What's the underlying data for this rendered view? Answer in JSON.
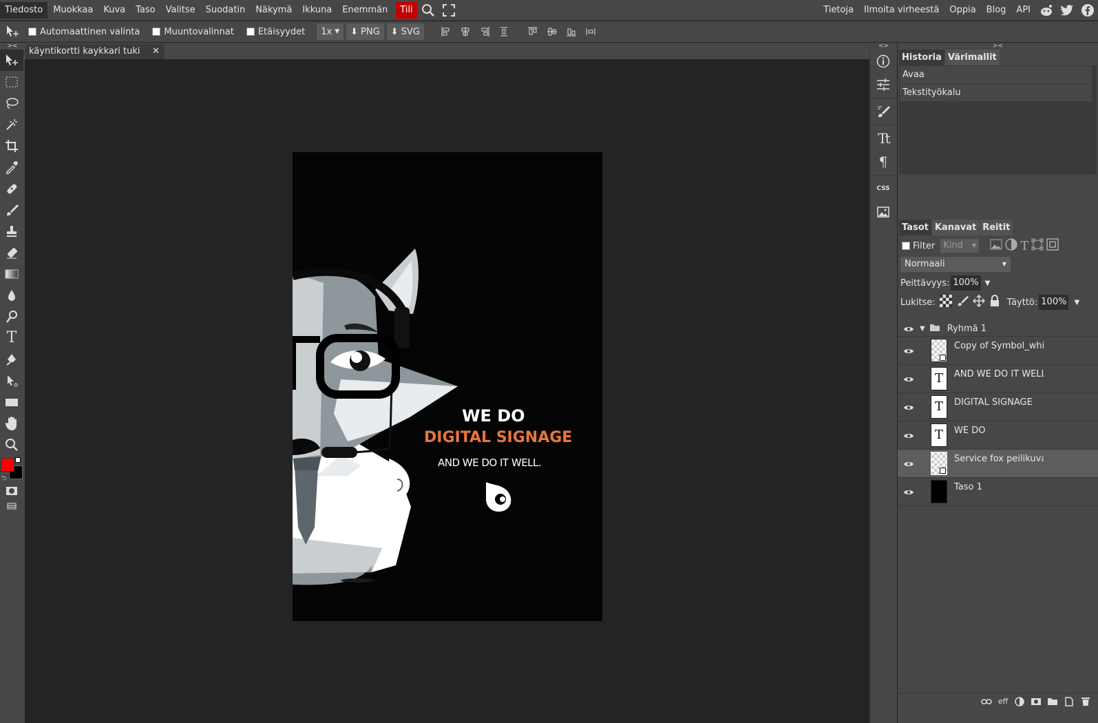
{
  "menubar": {
    "items": [
      "Tiedosto",
      "Muokkaa",
      "Kuva",
      "Taso",
      "Valitse",
      "Suodatin",
      "Näkymä",
      "Ikkuna",
      "Enemmän"
    ],
    "account": "Tili",
    "right": [
      "Tietoja",
      "Ilmoita virheestä",
      "Oppia",
      "Blog",
      "API"
    ]
  },
  "options": {
    "auto_select": "Automaattinen valinta",
    "transform": "Muuntovalinnat",
    "distances": "Etäisyydet",
    "zoom": "1x",
    "png": "PNG",
    "svg": "SVG"
  },
  "document": {
    "tab_title": "käyntikortti kaykkari tuki"
  },
  "poster": {
    "line1": "WE DO",
    "line2": "DIGITAL SIGNAGE",
    "line3": "AND WE DO IT WELL.",
    "accent_color": "#e8763c"
  },
  "strip": {
    "css_label": "CSS"
  },
  "history_panel": {
    "tabs": [
      "Historia",
      "Värimallit"
    ],
    "entries": [
      "Avaa",
      "Tekstityökalu"
    ]
  },
  "layers_panel": {
    "tabs": [
      "Tasot",
      "Kanavat",
      "Reitit"
    ],
    "filter_label": "Filter",
    "kind_label": "Kind",
    "blend_mode": "Normaali",
    "opacity_label": "Peittävyys:",
    "opacity_value": "100%",
    "lock_label": "Lukitse:",
    "fill_label": "Täyttö:",
    "fill_value": "100%",
    "group_name": "Ryhmä 1",
    "layers": [
      "Copy of Symbol_white",
      "AND WE DO IT WELL.",
      "DIGITAL SIGNAGE",
      "WE DO",
      "Service fox peilikuva l",
      "Taso 1"
    ],
    "footer_eff": "eff"
  },
  "colors": {
    "foreground": "#ff0000",
    "background": "#000000"
  }
}
